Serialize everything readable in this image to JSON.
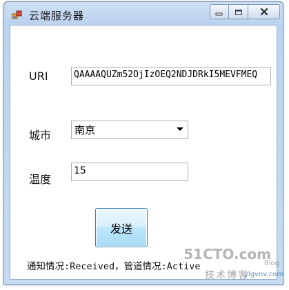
{
  "window": {
    "title": "云端服务器"
  },
  "form": {
    "uri_label": "URI",
    "uri_value": "QAAAAQUZm52OjIzOEQ2NDJDRkI5MEVFMEQ",
    "city_label": "城市",
    "city_value": "南京",
    "temp_label": "温度",
    "temp_value": "15",
    "send_label": "发送"
  },
  "status": {
    "text": "通知情况:Received，管道情况:Active"
  },
  "watermark": {
    "brand": "51CTO.com",
    "tagline": "技术博客",
    "blog": "Blog",
    "site": "ylgvnv.com"
  },
  "icons": {
    "app": "app-window-icon",
    "minimize": "minimize-icon",
    "maximize": "maximize-icon",
    "close": "close-icon",
    "dropdown": "chevron-down-icon"
  }
}
